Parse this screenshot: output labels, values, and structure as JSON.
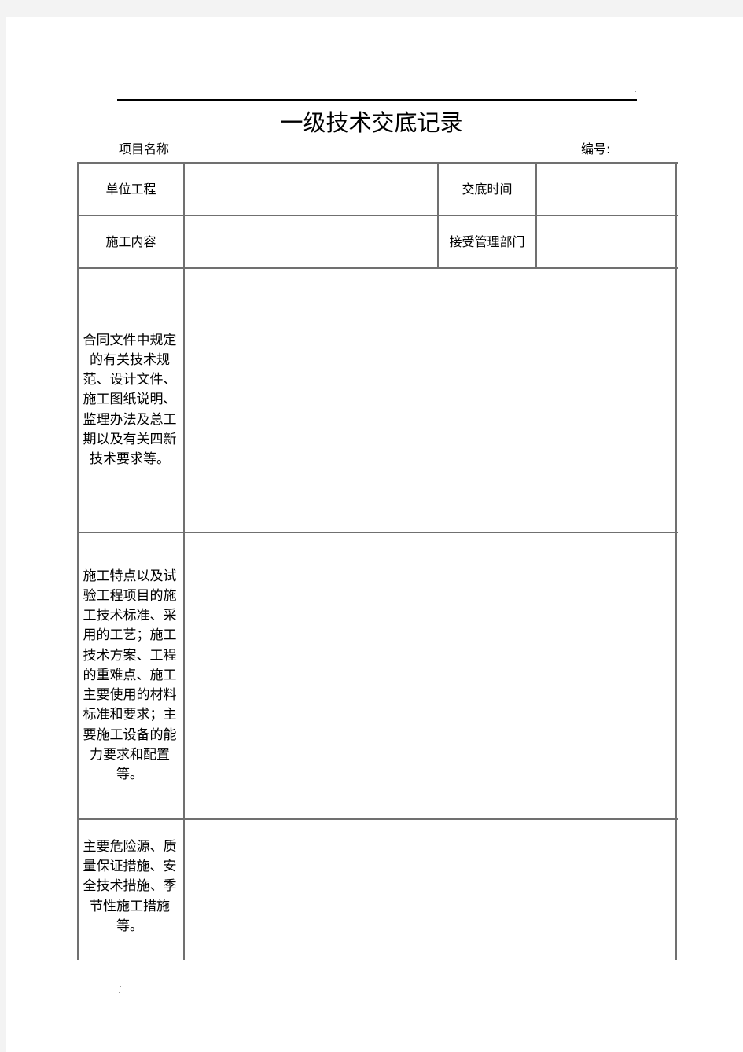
{
  "document": {
    "title": "一级技术交底记录",
    "project_name_label": "项目名称",
    "number_label": "编号:"
  },
  "table": {
    "row1": {
      "label_left": "单位工程",
      "value_left": "",
      "label_right": "交底时间",
      "value_right": ""
    },
    "row2": {
      "label_left": "施工内容",
      "value_left": "",
      "label_right": "接受管理部门",
      "value_right": ""
    },
    "sections": [
      {
        "label_lines": [
          "合同文件中规定",
          "的有关技术规",
          "范、设计文件、",
          "施工图纸说明、",
          "监理办法及总工",
          "期以及有关四新",
          "技术要求等。"
        ],
        "content": ""
      },
      {
        "label_lines": [
          "施工特点以及试",
          "验工程项目的施",
          "工技术标准、采",
          "用的工艺；施工",
          "技术方案、工程",
          "的重难点、施工",
          "主要使用的材料",
          "标准和要求；主",
          "要施工设备的能",
          "力要求和配置",
          "等。"
        ],
        "content": ""
      },
      {
        "label_lines": [
          "主要危险源、质",
          "量保证措施、安",
          "全技术措施、季",
          "节性施工措施",
          "等。"
        ],
        "content": ""
      }
    ]
  }
}
